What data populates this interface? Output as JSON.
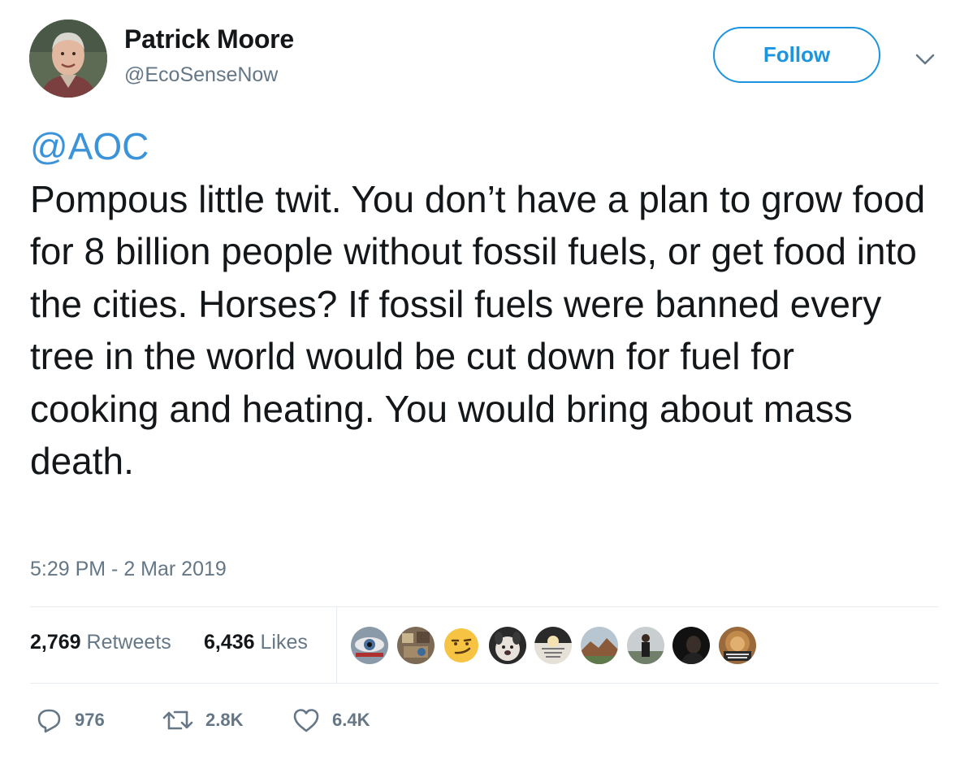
{
  "author": {
    "name": "Patrick Moore",
    "handle": "@EcoSenseNow"
  },
  "follow_button": {
    "label": "Follow"
  },
  "tweet": {
    "mention": "@AOC",
    "text": "Pompous little twit. You don’t have a plan to grow food for 8 billion people without fossil fuels, or get food into the cities. Horses? If fossil fuels were banned every tree in the world would be cut down for fuel for cooking and heating. You would bring about mass death.",
    "timestamp": "5:29 PM - 2 Mar 2019"
  },
  "stats": {
    "retweets": {
      "count": "2,769",
      "label": "Retweets"
    },
    "likes": {
      "count": "6,436",
      "label": "Likes"
    }
  },
  "liker_avatars": [
    {
      "icon": "eye-photo-avatar",
      "color": "#8a9aa8"
    },
    {
      "icon": "collage-avatar",
      "color": "#7c6a55"
    },
    {
      "icon": "smirk-emoji-avatar",
      "color": "#f6c343"
    },
    {
      "icon": "dog-avatar",
      "color": "#cfc6bd"
    },
    {
      "icon": "text-quote-avatar",
      "color": "#e6e1d8"
    },
    {
      "icon": "landscape-avatar",
      "color": "#9aa3a0"
    },
    {
      "icon": "person-outdoors-avatar",
      "color": "#6f7f6a"
    },
    {
      "icon": "dark-portrait-avatar",
      "color": "#111111"
    },
    {
      "icon": "lion-avatar",
      "color": "#9a6a3c"
    }
  ],
  "actions": {
    "reply": {
      "icon": "reply-icon",
      "count": "976"
    },
    "retweet": {
      "icon": "retweet-icon",
      "count": "2.8K"
    },
    "like": {
      "icon": "heart-icon",
      "count": "6.4K"
    }
  },
  "colors": {
    "accent": "#1b95e0",
    "mention": "#3b94d9",
    "secondary_text": "#657786",
    "primary_text": "#14171a",
    "divider": "#e6ecf0"
  }
}
